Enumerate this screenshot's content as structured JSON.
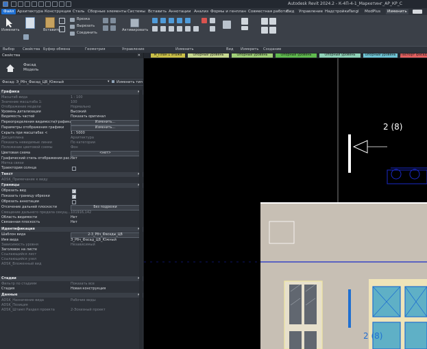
{
  "app": {
    "title": "Autodesk Revit 2024.2 - К-4П-4-1_Маркетинг_АР_КР_С"
  },
  "ribbon_tabs": [
    "Файл",
    "Архитектура",
    "Конструкция",
    "Сталь",
    "Сборные элементы",
    "Системы",
    "Вставить",
    "Аннотации",
    "Анализ",
    "Формы и генплан",
    "Совместная работа",
    "Вид",
    "Управление",
    "Надстройки",
    "Tangl",
    "ModPlus",
    "Изменить"
  ],
  "ribbon": {
    "modify": "Изменить",
    "properties": "Свойства",
    "paste": "Вставить",
    "cut": "Врезка",
    "cutout": "Вырезать",
    "join": "Соединить",
    "activate": "Активировать",
    "panels": [
      "Выбор",
      "Свойства",
      "Буфер обмена",
      "Геометрия",
      "Управление",
      "Изменить",
      "Вид",
      "Измерить",
      "Создание"
    ]
  },
  "view_tabs": [
    "М_План 1 этажа",
    "Опорный уровень",
    "Опорный уровень",
    "Опорный уровень",
    "Опорный уровень",
    "Опорный уровень",
    "Паспорт фасад"
  ],
  "properties": {
    "header": "Свойства",
    "type_family": "Фасад",
    "type_name": "Модель",
    "selector": "Фасад: Э_Рбч_Фасад_ЦВ_Южный",
    "edit_type": "Изменить тип",
    "sections": {
      "graphics": "Графика",
      "text": "Текст",
      "extents": "Границы",
      "identity": "Идентификация",
      "phasing": "Стадии",
      "data": "Данные"
    },
    "graphics_rows": [
      {
        "k": "Масштаб вида",
        "v": "1 : 100",
        "dim": true
      },
      {
        "k": "Значение масштаба  1:",
        "v": "100",
        "dim": true
      },
      {
        "k": "Отображение модели",
        "v": "Нормально",
        "dim": true
      },
      {
        "k": "Уровень детализации",
        "v": "Высокий",
        "dim": false
      },
      {
        "k": "Видимость частей",
        "v": "Показать оригинал",
        "dim": false
      }
    ],
    "vg_overrides": "Переопределения видимости/графики",
    "vg_button": "Изменить...",
    "display_options": "Параметры отображения графики",
    "display_button": "Изменить...",
    "hide_scale": "Скрыть при масштабах <",
    "hide_scale_value": "1 : 5000",
    "graphics_rows2": [
      {
        "k": "Дисциплина",
        "v": "Архитектура",
        "dim": true
      },
      {
        "k": "Показать невидимые линии",
        "v": "По категории",
        "dim": true
      },
      {
        "k": "Положение цветовой схемы",
        "v": "Фон",
        "dim": true
      }
    ],
    "color_scheme": "Цветовая схема",
    "color_scheme_value": "<нет>",
    "graphic_style": "Графический стиль отображения рас...",
    "graphic_style_value": "Нет",
    "default_pattern": "Метка связи",
    "sun_path": "Траектория солнца",
    "text_rows": [
      {
        "k": "ADSK_Примечание к виду",
        "v": ""
      }
    ],
    "extent_rows": [
      {
        "k": "Обрезать вид",
        "checked": true
      },
      {
        "k": "Показать границу обрезки",
        "checked": true
      },
      {
        "k": "Обрезать аннотации",
        "checked": false
      }
    ],
    "far_clip": "Отсечение дальней плоскости",
    "far_clip_value": "Без подрезки",
    "far_clip_offset": "Смещение дальнего предела секущ...",
    "far_clip_offset_value": "101916,142",
    "scope_box": "Область видимости",
    "scope_box_value": "Нет",
    "assoc_datum": "Связанная плоскость",
    "assoc_datum_value": "Нет",
    "template": "Шаблон вида",
    "template_value": "2-3_Рбч_Фасады_ЦВ",
    "view_name": "Имя вида",
    "view_name_value": "Э_Рбч_Фасад_ЦВ_Южный",
    "identity_rows": [
      {
        "k": "Зависимость уровня",
        "v": "Независимый",
        "dim": true
      },
      {
        "k": "Заголовок на листе",
        "v": "",
        "dim": false
      },
      {
        "k": "Ссылающийся лист",
        "v": "",
        "dim": true
      },
      {
        "k": "Ссылающийся узел",
        "v": "",
        "dim": true
      },
      {
        "k": "ADSK_Вложенный вид",
        "v": "",
        "dim": true
      }
    ],
    "phase_filter": "Фильтр по стадиям",
    "phase_filter_value": "Показать все",
    "phase": "Стадия",
    "phase_value": "Новая конструкция",
    "data_rows": [
      {
        "k": "ADSK_Назначение вида",
        "v": "Рабочие виды",
        "dim": true
      },
      {
        "k": "ADSK_Позиция",
        "v": "",
        "dim": true
      },
      {
        "k": "ADSK_Штамп Раздел проекта",
        "v": "2-Эскизный проект",
        "dim": true
      }
    ]
  },
  "canvas": {
    "section_label": "2 (8)",
    "section_label_bottom": "2 (8)"
  },
  "colors": {
    "accent": "#1f6fd1",
    "canvas": "#000000",
    "facade": "#c7bfb4",
    "glass": "#5fb0c6",
    "blue_lines": "#1a2ac8"
  }
}
